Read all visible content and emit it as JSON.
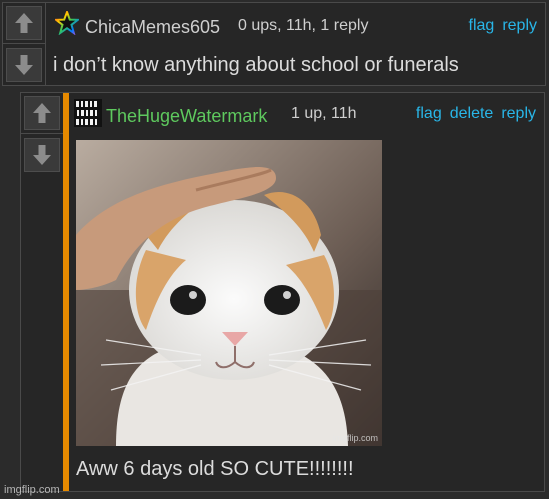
{
  "comments": [
    {
      "username": "ChicaMemes605",
      "meta": "0 ups, 11h, 1 reply",
      "actions": [
        "flag",
        "reply"
      ],
      "text": "i don’t know anything about school or funerals"
    },
    {
      "username": "TheHugeWatermark",
      "username_color": "#5ec95e",
      "meta": "1 up, 11h",
      "actions": [
        "flag",
        "delete",
        "reply"
      ],
      "text": "Aww 6 days old SO CUTE!!!!!!!!",
      "image_watermark": "imgflip.com"
    }
  ],
  "footer_watermark": "imgflip.com",
  "colors": {
    "link": "#29b6e8",
    "reply_bar": "#e68a00",
    "background": "#262626"
  }
}
